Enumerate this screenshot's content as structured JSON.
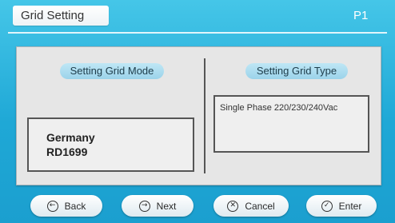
{
  "header": {
    "title": "Grid Setting",
    "page": "P1"
  },
  "grid_mode": {
    "label": "Setting Grid Mode",
    "country": "Germany",
    "standard": "RD1699"
  },
  "grid_type": {
    "label": "Setting Grid Type",
    "value": "Single Phase 220/230/240Vac"
  },
  "buttons": {
    "back": {
      "label": "Back",
      "icon": "arrow-left-icon"
    },
    "next": {
      "label": "Next",
      "icon": "arrow-right-icon"
    },
    "cancel": {
      "label": "Cancel",
      "icon": "cross-icon"
    },
    "enter": {
      "label": "Enter",
      "icon": "check-icon"
    }
  },
  "colors": {
    "background": "#1fa8d6",
    "panel": "#e6e6e6",
    "label_pill": "#9bd3ea"
  }
}
